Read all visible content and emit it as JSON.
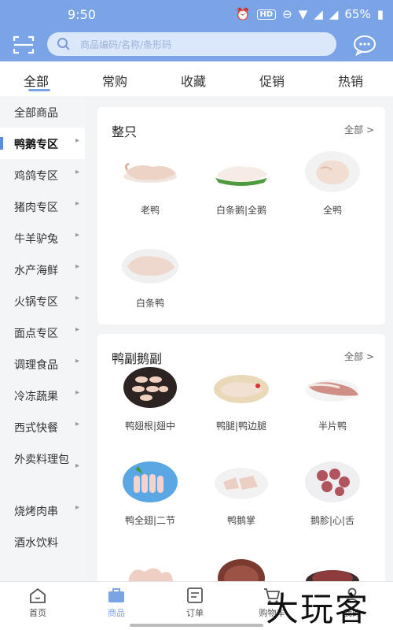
{
  "status": {
    "time": "9:50",
    "battery": "65%",
    "hd": "HD"
  },
  "search": {
    "placeholder": "商品编码/名称/条形码"
  },
  "top_tabs": [
    "全部",
    "常购",
    "收藏",
    "促销",
    "热销"
  ],
  "sidebar": {
    "items": [
      {
        "label": "全部商品"
      },
      {
        "label": "鸭鹅专区"
      },
      {
        "label": "鸡鸽专区"
      },
      {
        "label": "猪肉专区"
      },
      {
        "label": "牛羊驴兔"
      },
      {
        "label": "水产海鲜"
      },
      {
        "label": "火锅专区"
      },
      {
        "label": "面点专区"
      },
      {
        "label": "调理食品"
      },
      {
        "label": "冷冻蔬果"
      },
      {
        "label": "西式快餐"
      },
      {
        "label": "外卖料理包"
      },
      {
        "label": "烧烤肉串"
      },
      {
        "label": "酒水饮料"
      }
    ],
    "active": "鸭鹅专区"
  },
  "sections": [
    {
      "title": "整只",
      "all_label": "全部 >",
      "products": [
        "老鸭",
        "白条鹅|全鹅",
        "全鸭",
        "白条鸭"
      ]
    },
    {
      "title": "鸭副鹅副",
      "all_label": "全部 >",
      "products": [
        "鸭翅根|翅中",
        "鸭腿|鸭边腿",
        "半片鸭",
        "鸭全翅|二节",
        "鸭鹅掌",
        "鹅胗|心|舌"
      ]
    }
  ],
  "bottom_nav": [
    {
      "label": "首页",
      "icon": "home-icon"
    },
    {
      "label": "商品",
      "icon": "products-icon",
      "active": true
    },
    {
      "label": "订单",
      "icon": "orders-icon"
    },
    {
      "label": "购物车",
      "icon": "cart-icon"
    },
    {
      "label": "我的",
      "icon": "profile-icon"
    }
  ],
  "watermark": "大玩客",
  "colors": {
    "accent": "#7aa4e6"
  }
}
